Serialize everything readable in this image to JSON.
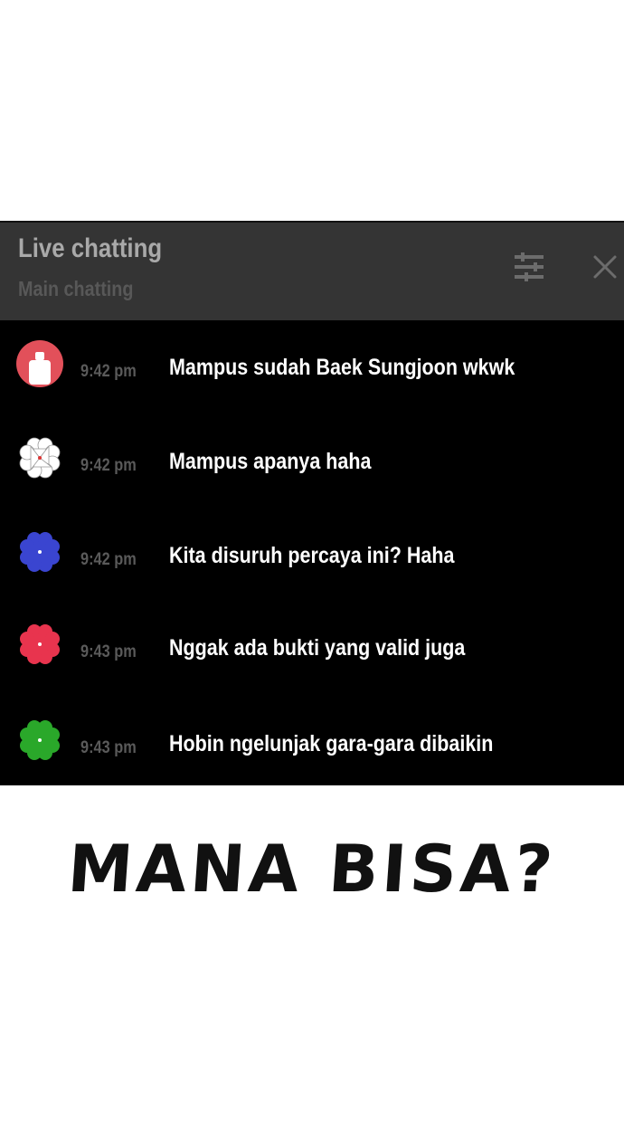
{
  "chat": {
    "title": "Live chatting",
    "subtitle": "Main chatting",
    "messages": [
      {
        "time": "9:42 pm",
        "text": "Mampus sudah Baek Sungjoon wkwk",
        "avatar": "user-profile-icon",
        "avatar_color": "#e2505a"
      },
      {
        "time": "9:42 pm",
        "text": "Mampus apanya haha",
        "avatar": "clover-icon",
        "avatar_color": "#ffffff"
      },
      {
        "time": "9:42 pm",
        "text": "Kita disuruh percaya ini? Haha",
        "avatar": "clover-icon",
        "avatar_color": "#3a45d0"
      },
      {
        "time": "9:43 pm",
        "text": "Nggak ada bukti yang valid juga",
        "avatar": "clover-icon",
        "avatar_color": "#e8344e"
      },
      {
        "time": "9:43 pm",
        "text": "Hobin ngelunjak gara-gara dibaikin",
        "avatar": "clover-icon",
        "avatar_color": "#2aa82a"
      }
    ]
  },
  "caption": "MANA BISA?",
  "colors": {
    "header_bg": "#343434",
    "panel_bg": "#000000",
    "title": "#a9a9a9",
    "subtitle": "#585858"
  },
  "icons": {
    "filter": "filter-sliders-icon",
    "close": "close-icon"
  }
}
